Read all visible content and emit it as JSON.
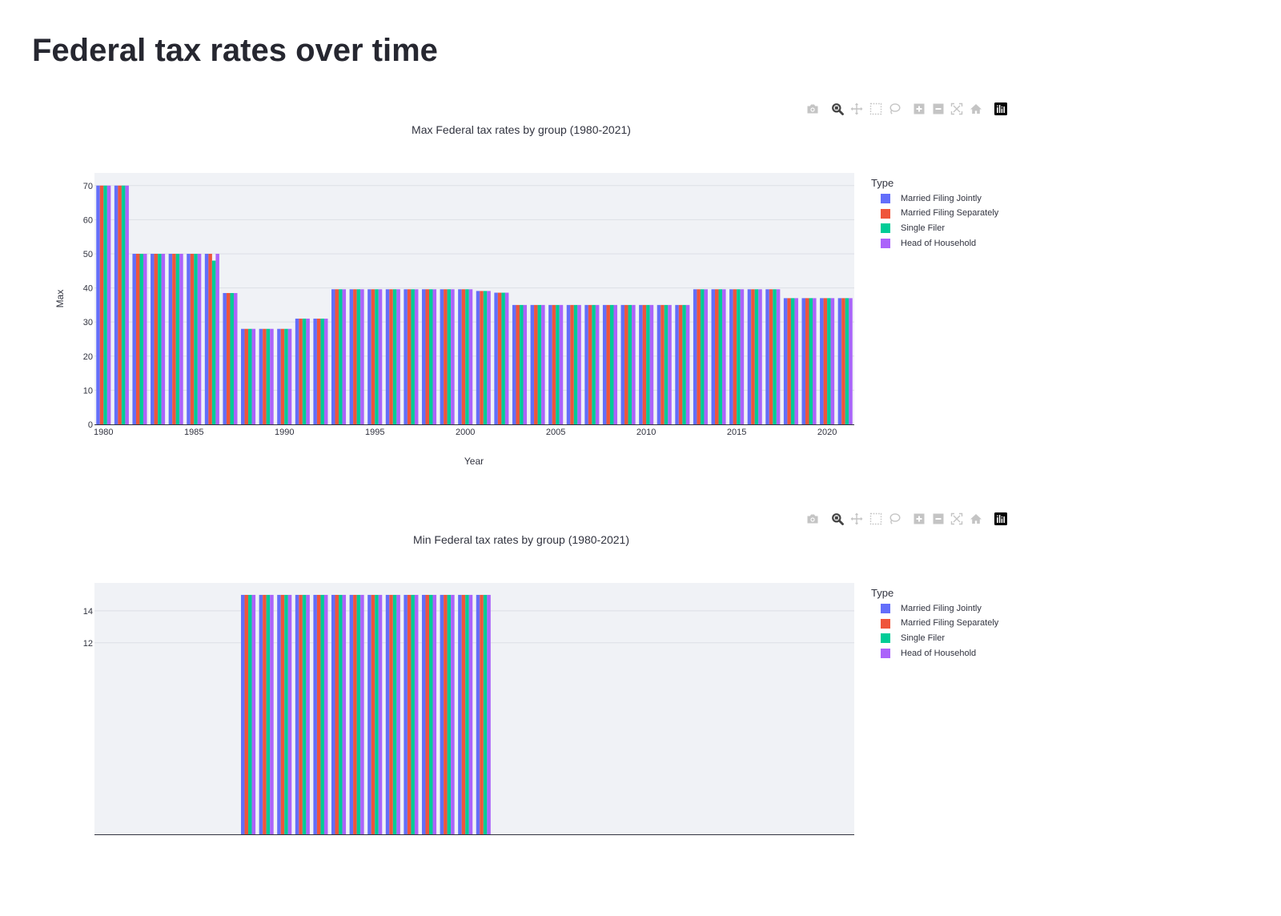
{
  "page": {
    "title": "Federal tax rates over time"
  },
  "modebar": {
    "icons": [
      "camera-icon",
      "zoom-icon",
      "pan-icon",
      "box-select-icon",
      "lasso-select-icon",
      "zoom-in-icon",
      "zoom-out-icon",
      "autoscale-icon",
      "reset-axes-icon",
      "plotly-logo-icon"
    ],
    "active": "zoom-icon",
    "colors": {
      "inactive": "#c4c4c4",
      "active": "#444444",
      "logo_bg": "#000000"
    }
  },
  "chart_data": [
    {
      "type": "bar",
      "barmode": "group",
      "title": "Max Federal tax rates by group (1980-2021)",
      "xlabel": "Year",
      "ylabel": "Max",
      "xlim": [
        1979.5,
        2021.5
      ],
      "ylim": [
        0,
        73.7
      ],
      "x_ticks": [
        1980,
        1985,
        1990,
        1995,
        2000,
        2005,
        2010,
        2015,
        2020
      ],
      "y_ticks": [
        0,
        10,
        20,
        30,
        40,
        50,
        60,
        70
      ],
      "grid": true,
      "legend_title": "Type",
      "legend_position": "right",
      "plot_bgcolor": "#f0f2f6",
      "x": [
        1980,
        1981,
        1982,
        1983,
        1984,
        1985,
        1986,
        1987,
        1988,
        1989,
        1990,
        1991,
        1992,
        1993,
        1994,
        1995,
        1996,
        1997,
        1998,
        1999,
        2000,
        2001,
        2002,
        2003,
        2004,
        2005,
        2006,
        2007,
        2008,
        2009,
        2010,
        2011,
        2012,
        2013,
        2014,
        2015,
        2016,
        2017,
        2018,
        2019,
        2020,
        2021
      ],
      "series": [
        {
          "name": "Married Filing Jointly",
          "color": "#636efa",
          "values": [
            70,
            70,
            50,
            50,
            50,
            50,
            50,
            38.5,
            28,
            28,
            28,
            31,
            31,
            39.6,
            39.6,
            39.6,
            39.6,
            39.6,
            39.6,
            39.6,
            39.6,
            39.1,
            38.6,
            35,
            35,
            35,
            35,
            35,
            35,
            35,
            35,
            35,
            35,
            39.6,
            39.6,
            39.6,
            39.6,
            39.6,
            37,
            37,
            37,
            37
          ]
        },
        {
          "name": "Married Filing Separately",
          "color": "#ef553b",
          "values": [
            70,
            70,
            50,
            50,
            50,
            50,
            50,
            38.5,
            28,
            28,
            28,
            31,
            31,
            39.6,
            39.6,
            39.6,
            39.6,
            39.6,
            39.6,
            39.6,
            39.6,
            39.1,
            38.6,
            35,
            35,
            35,
            35,
            35,
            35,
            35,
            35,
            35,
            35,
            39.6,
            39.6,
            39.6,
            39.6,
            39.6,
            37,
            37,
            37,
            37
          ]
        },
        {
          "name": "Single Filer",
          "color": "#00cc96",
          "values": [
            70,
            70,
            50,
            50,
            50,
            50,
            48,
            38.5,
            28,
            28,
            28,
            31,
            31,
            39.6,
            39.6,
            39.6,
            39.6,
            39.6,
            39.6,
            39.6,
            39.6,
            39.1,
            38.6,
            35,
            35,
            35,
            35,
            35,
            35,
            35,
            35,
            35,
            35,
            39.6,
            39.6,
            39.6,
            39.6,
            39.6,
            37,
            37,
            37,
            37
          ]
        },
        {
          "name": "Head of Household",
          "color": "#ab63fa",
          "values": [
            70,
            70,
            50,
            50,
            50,
            50,
            50,
            38.5,
            28,
            28,
            28,
            31,
            31,
            39.6,
            39.6,
            39.6,
            39.6,
            39.6,
            39.6,
            39.6,
            39.6,
            39.1,
            38.6,
            35,
            35,
            35,
            35,
            35,
            35,
            35,
            35,
            35,
            35,
            39.6,
            39.6,
            39.6,
            39.6,
            39.6,
            37,
            37,
            37,
            37
          ]
        }
      ]
    },
    {
      "type": "bar",
      "barmode": "group",
      "title": "Min Federal tax rates by group (1980-2021)",
      "xlabel": "",
      "ylabel": "",
      "xlim": [
        1979.5,
        2021.5
      ],
      "ylim": [
        0,
        15.75
      ],
      "x_ticks": [],
      "y_ticks": [
        12,
        14
      ],
      "grid": true,
      "legend_title": "Type",
      "legend_position": "right",
      "plot_bgcolor": "#f0f2f6",
      "x": [
        1980,
        1981,
        1982,
        1983,
        1984,
        1985,
        1986,
        1987,
        1988,
        1989,
        1990,
        1991,
        1992,
        1993,
        1994,
        1995,
        1996,
        1997,
        1998,
        1999,
        2000,
        2001,
        2002,
        2003,
        2004,
        2005,
        2006,
        2007,
        2008,
        2009,
        2010,
        2011,
        2012,
        2013,
        2014,
        2015,
        2016,
        2017,
        2018,
        2019,
        2020,
        2021
      ],
      "series": [
        {
          "name": "Married Filing Jointly",
          "color": "#636efa",
          "values": [
            null,
            null,
            null,
            null,
            null,
            null,
            null,
            null,
            15,
            15,
            15,
            15,
            15,
            15,
            15,
            15,
            15,
            15,
            15,
            15,
            15,
            15,
            null,
            null,
            null,
            null,
            null,
            null,
            null,
            null,
            null,
            null,
            null,
            null,
            null,
            null,
            null,
            null,
            null,
            null,
            null,
            null
          ]
        },
        {
          "name": "Married Filing Separately",
          "color": "#ef553b",
          "values": [
            null,
            null,
            null,
            null,
            null,
            null,
            null,
            null,
            15,
            15,
            15,
            15,
            15,
            15,
            15,
            15,
            15,
            15,
            15,
            15,
            15,
            15,
            null,
            null,
            null,
            null,
            null,
            null,
            null,
            null,
            null,
            null,
            null,
            null,
            null,
            null,
            null,
            null,
            null,
            null,
            null,
            null
          ]
        },
        {
          "name": "Single Filer",
          "color": "#00cc96",
          "values": [
            null,
            null,
            null,
            null,
            null,
            null,
            null,
            null,
            15,
            15,
            15,
            15,
            15,
            15,
            15,
            15,
            15,
            15,
            15,
            15,
            15,
            15,
            null,
            null,
            null,
            null,
            null,
            null,
            null,
            null,
            null,
            null,
            null,
            null,
            null,
            null,
            null,
            null,
            null,
            null,
            null,
            null
          ]
        },
        {
          "name": "Head of Household",
          "color": "#ab63fa",
          "values": [
            null,
            null,
            null,
            null,
            null,
            null,
            null,
            null,
            15,
            15,
            15,
            15,
            15,
            15,
            15,
            15,
            15,
            15,
            15,
            15,
            15,
            15,
            null,
            null,
            null,
            null,
            null,
            null,
            null,
            null,
            null,
            null,
            null,
            null,
            null,
            null,
            null,
            null,
            null,
            null,
            null,
            null
          ]
        }
      ]
    }
  ]
}
